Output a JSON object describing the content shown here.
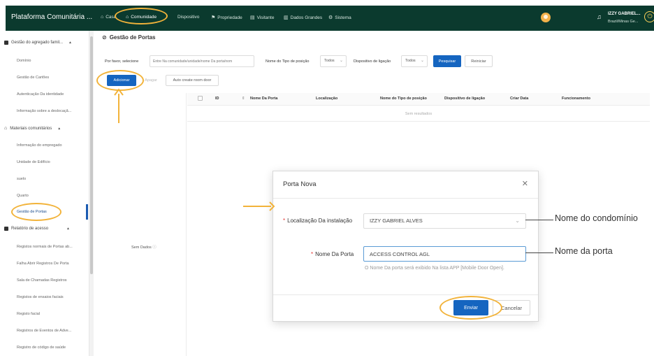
{
  "topbar": {
    "brand": "Plataforma Comunitária ...",
    "nav": [
      {
        "label": "Casa",
        "icon": "home-icon"
      },
      {
        "label": "Comunidade",
        "icon": "home-icon"
      },
      {
        "label": "Dispositivo",
        "icon": "device-icon"
      },
      {
        "label": "Propriedade",
        "icon": "property-icon"
      },
      {
        "label": "Visitante",
        "icon": "visitor-icon"
      },
      {
        "label": "Dados Grandes",
        "icon": "chart-icon"
      },
      {
        "label": "Sistema",
        "icon": "gear-icon"
      }
    ],
    "user_name": "IZZY GABRIEL...",
    "user_location": "Brazil/Minas Ge..."
  },
  "sidebar": {
    "groups": [
      {
        "label": "Gestão do agregado famil...",
        "items": [
          "Domínio",
          "Gestão de Cartões",
          "Autenticação Da identidade",
          "Informação sobre a deslocaçã..."
        ]
      },
      {
        "label": "Materiais comunitários",
        "items": [
          "Informação do empregado",
          "Unidade de Edifício",
          "suelo",
          "Quarto",
          "Gestão de Portas"
        ]
      },
      {
        "label": "Relatório de acesso",
        "items": [
          "Registos normais de Portas ab...",
          "Falha Abrir Registros De Porta",
          "Sala de Chamadas Registros",
          "Registos de ensaios faciais",
          "Registo facial",
          "Registros de Eventos de Adve...",
          "Registro de código de saúde"
        ]
      }
    ],
    "active_item": "Gestão de Portas"
  },
  "main": {
    "title": "Gestão de Portas",
    "filter": {
      "select_label": "Por favor, selecione",
      "search_placeholder": "Entre Na comunidade/unidade/nome Da porta/nom",
      "type_label": "Nome do Tipo de posição",
      "type_value": "Todos",
      "device_label": "Dispositivo de ligação",
      "device_value": "Todos",
      "search_button": "Pesquisar",
      "reset_button": "Reiniciar"
    },
    "actions": {
      "add": "Adicionar",
      "delete": "Apagar",
      "auto_create": "Auto create room door"
    },
    "table": {
      "columns": [
        "ID",
        "Nome Da Porta",
        "Localização",
        "Nome do Tipo de posição",
        "Dispositivo de ligação",
        "Criar Data",
        "Funcionamento"
      ],
      "empty_text": "Sem resultados"
    },
    "tree_empty": "Sem Dados"
  },
  "modal": {
    "title": "Porta Nova",
    "location_label": "Localização Da instalação",
    "location_value": "IZZY GABRIEL ALVES",
    "name_label": "Nome Da Porta",
    "name_value": "ACCESS CONTROL AGL",
    "hint": "O Nome Da porta será exibido Na lista APP [Mobile Door Open].",
    "submit": "Enviar",
    "cancel": "Cancelar"
  },
  "annotations": {
    "condo_label": "Nome do condomínio",
    "door_label": "Nome da porta"
  },
  "colors": {
    "navbar": "#0b3a2e",
    "primary": "#1565c0",
    "highlight": "#f2b33a"
  }
}
